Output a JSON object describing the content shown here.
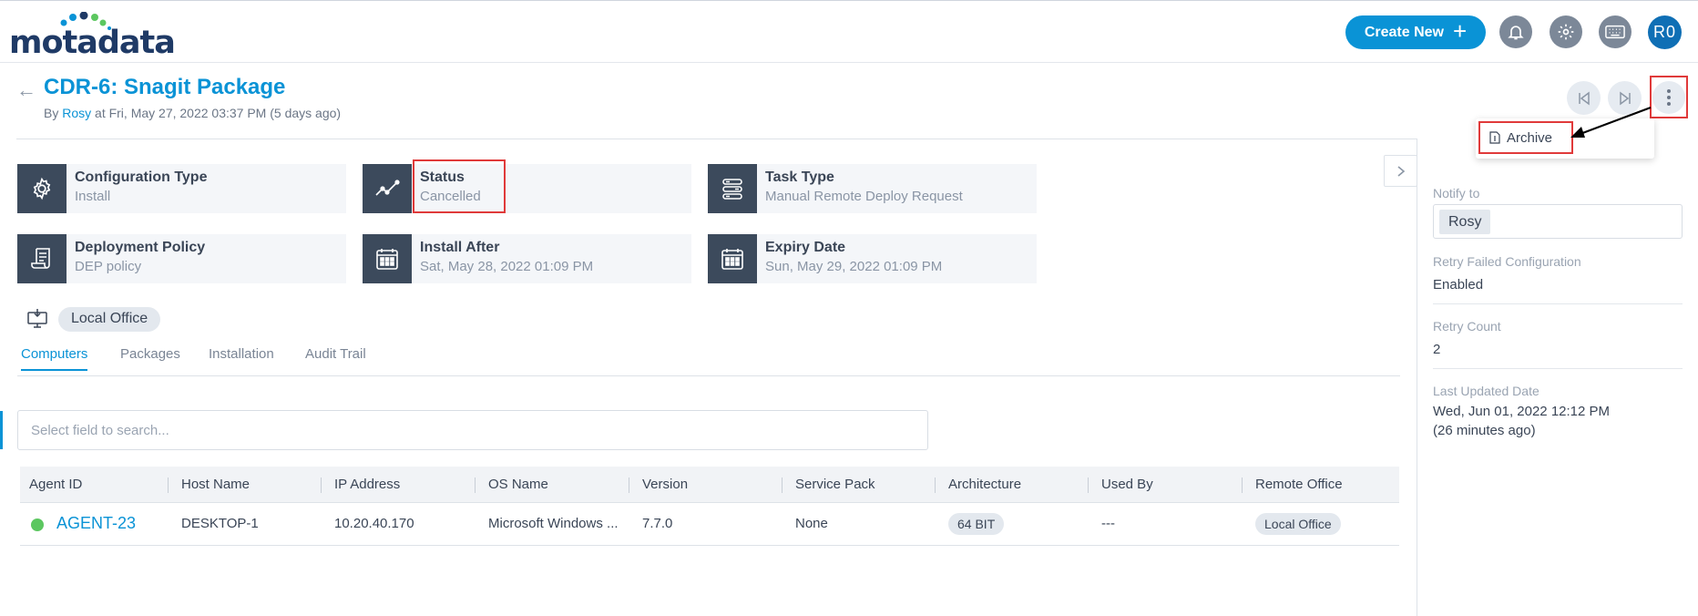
{
  "header": {
    "logo_text": "motadata",
    "create_label": "Create New",
    "avatar_initials": "R0"
  },
  "request": {
    "title": "CDR-6: Snagit Package",
    "by_prefix": "By",
    "author": "Rosy",
    "timestamp": "at Fri, May 27, 2022 03:37 PM (5 days ago)"
  },
  "menu": {
    "archive_label": "Archive"
  },
  "cards": [
    {
      "label": "Configuration Type",
      "value": "Install",
      "icon": "gear-icon"
    },
    {
      "label": "Status",
      "value": "Cancelled",
      "icon": "trend-line-icon"
    },
    {
      "label": "Task Type",
      "value": "Manual Remote Deploy Request",
      "icon": "tasks-icon"
    },
    {
      "label": "Deployment Policy",
      "value": "DEP policy",
      "icon": "policy-scroll-icon"
    },
    {
      "label": "Install After",
      "value": "Sat, May 28, 2022 01:09 PM",
      "icon": "calendar-icon"
    },
    {
      "label": "Expiry Date",
      "value": "Sun, May 29, 2022 01:09 PM",
      "icon": "calendar-icon"
    }
  ],
  "location": "Local Office",
  "tabs": [
    "Computers",
    "Packages",
    "Installation",
    "Audit Trail"
  ],
  "search": {
    "placeholder": "Select field to search..."
  },
  "table": {
    "columns": [
      "Agent ID",
      "Host Name",
      "IP Address",
      "OS Name",
      "Version",
      "Service Pack",
      "Architecture",
      "Used By",
      "Remote Office"
    ],
    "rows": [
      {
        "agent_id": "AGENT-23",
        "host_name": "DESKTOP-1",
        "ip": "10.20.40.170",
        "os": "Microsoft Windows ...",
        "version": "7.7.0",
        "service_pack": "None",
        "architecture": "64 BIT",
        "used_by": "---",
        "remote_office": "Local Office",
        "status_color": "#5cc760"
      }
    ]
  },
  "sidebar": {
    "notify_label": "Notify to",
    "notify_user": "Rosy",
    "retry_label": "Retry Failed Configuration",
    "retry_value": "Enabled",
    "retry_count_label": "Retry Count",
    "retry_count_value": "2",
    "updated_label": "Last Updated Date",
    "updated_value": "Wed, Jun 01, 2022 12:12 PM",
    "updated_ago": "(26 minutes ago)"
  },
  "colors": {
    "accent": "#0a93d6",
    "highlight": "#e03a3a",
    "card_icon_bg": "#3c4a5c"
  }
}
